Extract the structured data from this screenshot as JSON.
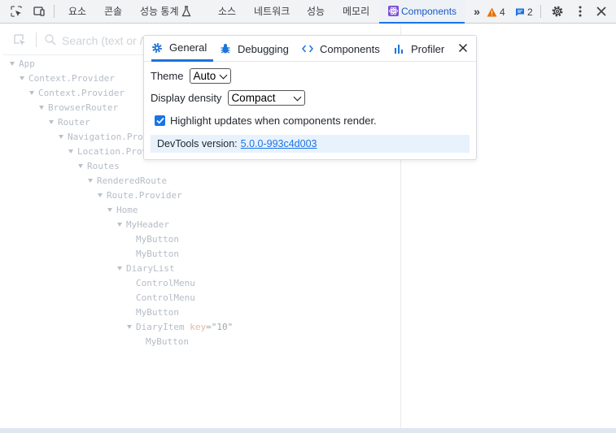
{
  "toolbar": {
    "tabs": [
      "요소",
      "콘솔",
      "성능 통계",
      "소스",
      "네트워크",
      "성능",
      "메모리",
      "Components"
    ],
    "warning_count": "4",
    "message_count": "2",
    "colors": {
      "active_tab": "#1a73e8",
      "warning": "#e8710a",
      "react_badge": "#7d4fd6"
    }
  },
  "search": {
    "placeholder": "Search (text or /regex/)"
  },
  "tree": [
    {
      "label": "App"
    },
    {
      "label": "Context.Provider"
    },
    {
      "label": "Context.Provider"
    },
    {
      "label": "BrowserRouter"
    },
    {
      "label": "Router"
    },
    {
      "label": "Navigation.Provider"
    },
    {
      "label": "Location.Provider"
    },
    {
      "label": "Routes"
    },
    {
      "label": "RenderedRoute"
    },
    {
      "label": "Route.Provider"
    },
    {
      "label": "Home"
    },
    {
      "label": "MyHeader"
    },
    {
      "label": "MyButton"
    },
    {
      "label": "MyButton"
    },
    {
      "label": "DiaryList"
    },
    {
      "label": "ControlMenu"
    },
    {
      "label": "ControlMenu"
    },
    {
      "label": "MyButton"
    },
    {
      "label": "DiaryItem",
      "key_name": "key",
      "key_value": "\"10\""
    },
    {
      "label": "MyButton"
    }
  ],
  "settings": {
    "tabs": [
      {
        "label": "General",
        "icon": "gear-icon"
      },
      {
        "label": "Debugging",
        "icon": "bug-icon"
      },
      {
        "label": "Components",
        "icon": "code-icon"
      },
      {
        "label": "Profiler",
        "icon": "bar-chart-icon"
      }
    ],
    "active_tab": "General",
    "theme_label": "Theme",
    "theme_value": "Auto",
    "density_label": "Display density",
    "density_value": "Compact",
    "highlight_label": "Highlight updates when components render.",
    "highlight_checked": true,
    "version_label": "DevTools version:",
    "version_link": "5.0.0-993c4d003"
  }
}
